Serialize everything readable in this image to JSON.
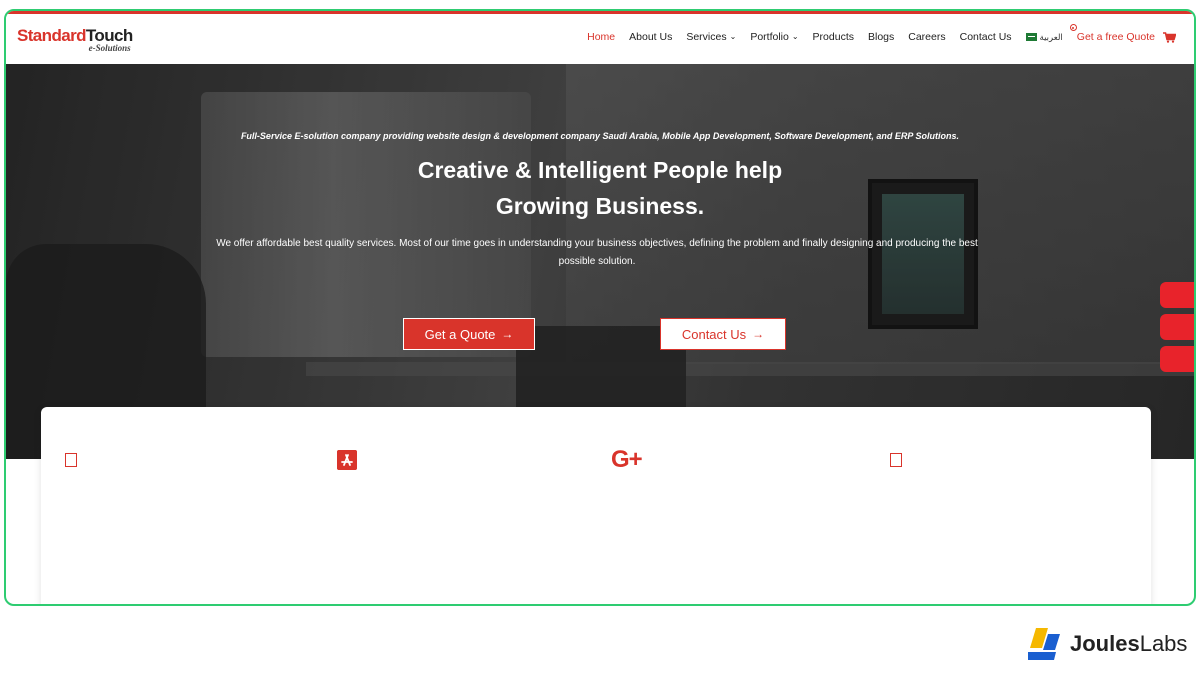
{
  "header": {
    "logo_main_a": "Standard",
    "logo_main_b": "Touch",
    "logo_sub": "e-Solutions",
    "nav": [
      {
        "label": "Home",
        "active": true
      },
      {
        "label": "About Us"
      },
      {
        "label": "Services",
        "dropdown": true
      },
      {
        "label": "Portfolio",
        "dropdown": true
      },
      {
        "label": "Products"
      },
      {
        "label": "Blogs"
      },
      {
        "label": "Careers"
      },
      {
        "label": "Contact Us"
      }
    ],
    "language_label": "العربية",
    "quote_link": "Get a free Quote",
    "chevron": "⌄"
  },
  "hero": {
    "kicker": "Full-Service E-solution company providing website design & development company Saudi Arabia, Mobile App Development, Software Development, and ERP Solutions.",
    "title_line1": "Creative & Intelligent People help",
    "title_line2": "Growing Business.",
    "description": "We offer affordable best quality services. Most of our time goes in understanding your business objectives, defining the problem and finally designing and producing the best possible solution.",
    "btn_quote": "Get a Quote",
    "btn_contact": "Contact Us",
    "arrow": "→"
  },
  "card": {
    "icons": [
      "document-icon",
      "app-store-icon",
      "google-plus-icon",
      "document-icon"
    ],
    "gplus_text": "G+"
  },
  "brand": {
    "name_a": "Joules",
    "name_b": "Labs"
  },
  "colors": {
    "accent": "#d9342b",
    "frame_border": "#2ecc71",
    "side_tab": "#e8232b"
  }
}
